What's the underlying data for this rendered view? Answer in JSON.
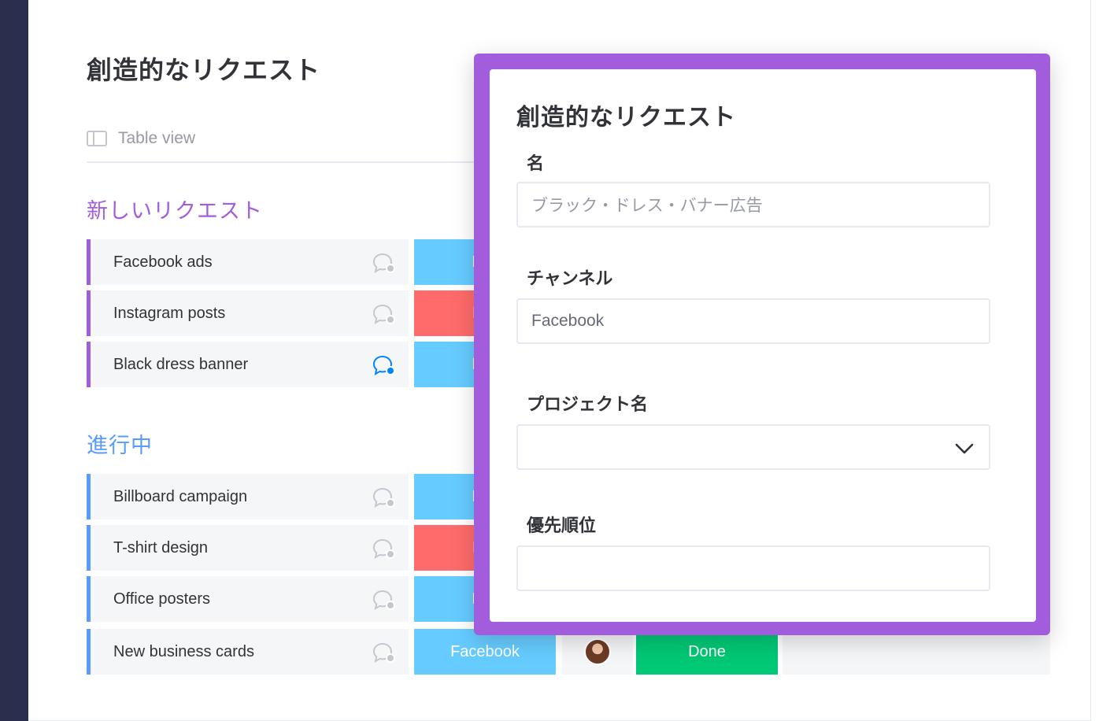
{
  "board": {
    "title": "創造的なリクエスト",
    "view_tab": "Table view"
  },
  "groups": [
    {
      "title": "新しいリクエスト",
      "color": "#a25ddc",
      "rows": [
        {
          "name": "Facebook ads",
          "channel": "Fac",
          "channel_color": "#66ccff",
          "chat_active": false
        },
        {
          "name": "Instagram posts",
          "channel": "Inst",
          "channel_color": "#ff6b6b",
          "chat_active": false
        },
        {
          "name": "Black dress banner",
          "channel": "Fac",
          "channel_color": "#66ccff",
          "chat_active": true
        }
      ]
    },
    {
      "title": "進行中",
      "color": "#579bfc",
      "rows": [
        {
          "name": "Billboard campaign",
          "channel": "Fac",
          "channel_color": "#66ccff",
          "chat_active": false
        },
        {
          "name": "T-shirt design",
          "channel": "Inst",
          "channel_color": "#ff6b6b",
          "chat_active": false
        },
        {
          "name": "Office posters",
          "channel": "Fac",
          "channel_color": "#66ccff",
          "chat_active": false
        },
        {
          "name": "New business cards",
          "channel": "Facebook",
          "channel_color": "#66ccff",
          "chat_active": false,
          "status": "Done",
          "status_color": "#00c875"
        }
      ]
    }
  ],
  "modal": {
    "title": "創造的なリクエスト",
    "fields": {
      "name": {
        "label": "名",
        "placeholder": "ブラック・ドレス・バナー広告"
      },
      "channel": {
        "label": "チャンネル",
        "value": "Facebook"
      },
      "project": {
        "label": "プロジェクト名",
        "value": ""
      },
      "priority": {
        "label": "優先順位",
        "value": ""
      }
    }
  },
  "icons": {
    "chat": "chat-bubble-icon",
    "view": "table-view-icon",
    "dropdown": "chevron-down-icon"
  },
  "colors": {
    "modal_border": "#a25ddc",
    "sidebar": "#292f4c",
    "chat_active": "#0085ff",
    "chat_inactive": "#c5c7d0"
  }
}
